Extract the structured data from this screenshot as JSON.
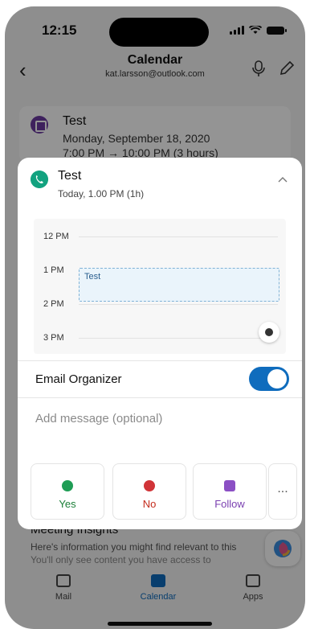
{
  "status": {
    "time": "12:15"
  },
  "nav": {
    "title": "Calendar",
    "account": "kat.larsson@outlook.com"
  },
  "background_event": {
    "title": "Test",
    "date": "Monday, September 18, 2020",
    "time": "7:00 PM → 10:00 PM (3 hours)"
  },
  "card": {
    "title": "Test",
    "subtitle": "Today, 1.00 PM (1h)",
    "timeline": {
      "hours": [
        "12 PM",
        "1 PM",
        "2 PM",
        "3 PM"
      ],
      "event_label": "Test"
    },
    "email_organizer_label": "Email Organizer",
    "email_organizer_on": true,
    "message_placeholder": "Add message (optional)",
    "rsvp": {
      "yes": "Yes",
      "no": "No",
      "follow": "Follow",
      "more": "..."
    }
  },
  "insights": {
    "title": "Meeting Insights",
    "text": "Here's information you might find relevant to this",
    "text2": "You'll only see content you have access to"
  },
  "tabs": [
    {
      "label": "Mail",
      "icon": "mail-icon"
    },
    {
      "label": "Calendar",
      "icon": "calendar-icon",
      "active": true
    },
    {
      "label": "Apps",
      "icon": "apps-icon"
    }
  ],
  "colors": {
    "accent": "#0f6cbd",
    "yes": "#1a7f37",
    "no": "#c42b1c",
    "follow": "#7a3fb0"
  }
}
